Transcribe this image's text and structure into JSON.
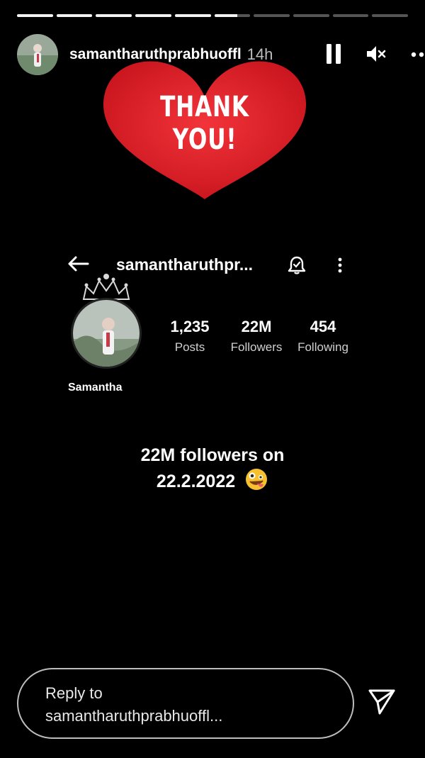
{
  "story": {
    "progress": [
      1,
      1,
      1,
      1,
      1,
      0.65,
      0,
      0,
      0,
      0
    ],
    "username": "samantharuthprabhuoffl",
    "time_ago": "14h",
    "icons": [
      "pause-icon",
      "mute-icon",
      "more-icon"
    ]
  },
  "sticker": {
    "text": "THANK YOU!",
    "color": "#e0202a"
  },
  "profile": {
    "handle": "samantharuthpr...",
    "display_name": "Samantha",
    "stats": [
      {
        "value": "1,235",
        "label": "Posts"
      },
      {
        "value": "22M",
        "label": "Followers"
      },
      {
        "value": "454",
        "label": "Following"
      }
    ]
  },
  "caption": {
    "line1": "22M followers on",
    "line2": "22.2.2022"
  },
  "reply": {
    "line1": "Reply to",
    "line2": "samantharuthprabhuoffl..."
  }
}
